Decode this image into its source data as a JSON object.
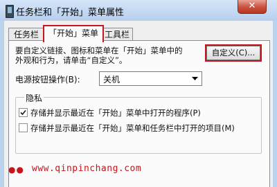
{
  "window": {
    "title": "任务栏和「开始」菜单属性",
    "close_glyph": "✕"
  },
  "tabs": [
    {
      "label": "任务栏",
      "active": false
    },
    {
      "label": "「开始」菜单",
      "active": true
    },
    {
      "label": "工具栏",
      "active": false
    }
  ],
  "start_menu_tab": {
    "description_line1": "要自定义链接、图标和菜单在「开始」菜单中的",
    "description_line2": "外观和行为，请单击“自定义”。",
    "customize_button_label": "自定义(C)...",
    "power_button_label": "电源按钮操作(B):",
    "power_button_value": "关机",
    "privacy": {
      "title": "隐私",
      "options": [
        {
          "label": "存储并显示最近在「开始」菜单中打开的程序(P)",
          "checked": true
        },
        {
          "label": "存储并显示最近在「开始」菜单和任务栏中打开的项目(M)",
          "checked": false
        }
      ]
    }
  },
  "watermark": {
    "dots": "●●",
    "text": "www.qinpinchang.com"
  },
  "colors": {
    "highlight_red": "#c8141d",
    "title_bar": "#bcd3ee",
    "dialog_bg": "#f0f0f0"
  }
}
